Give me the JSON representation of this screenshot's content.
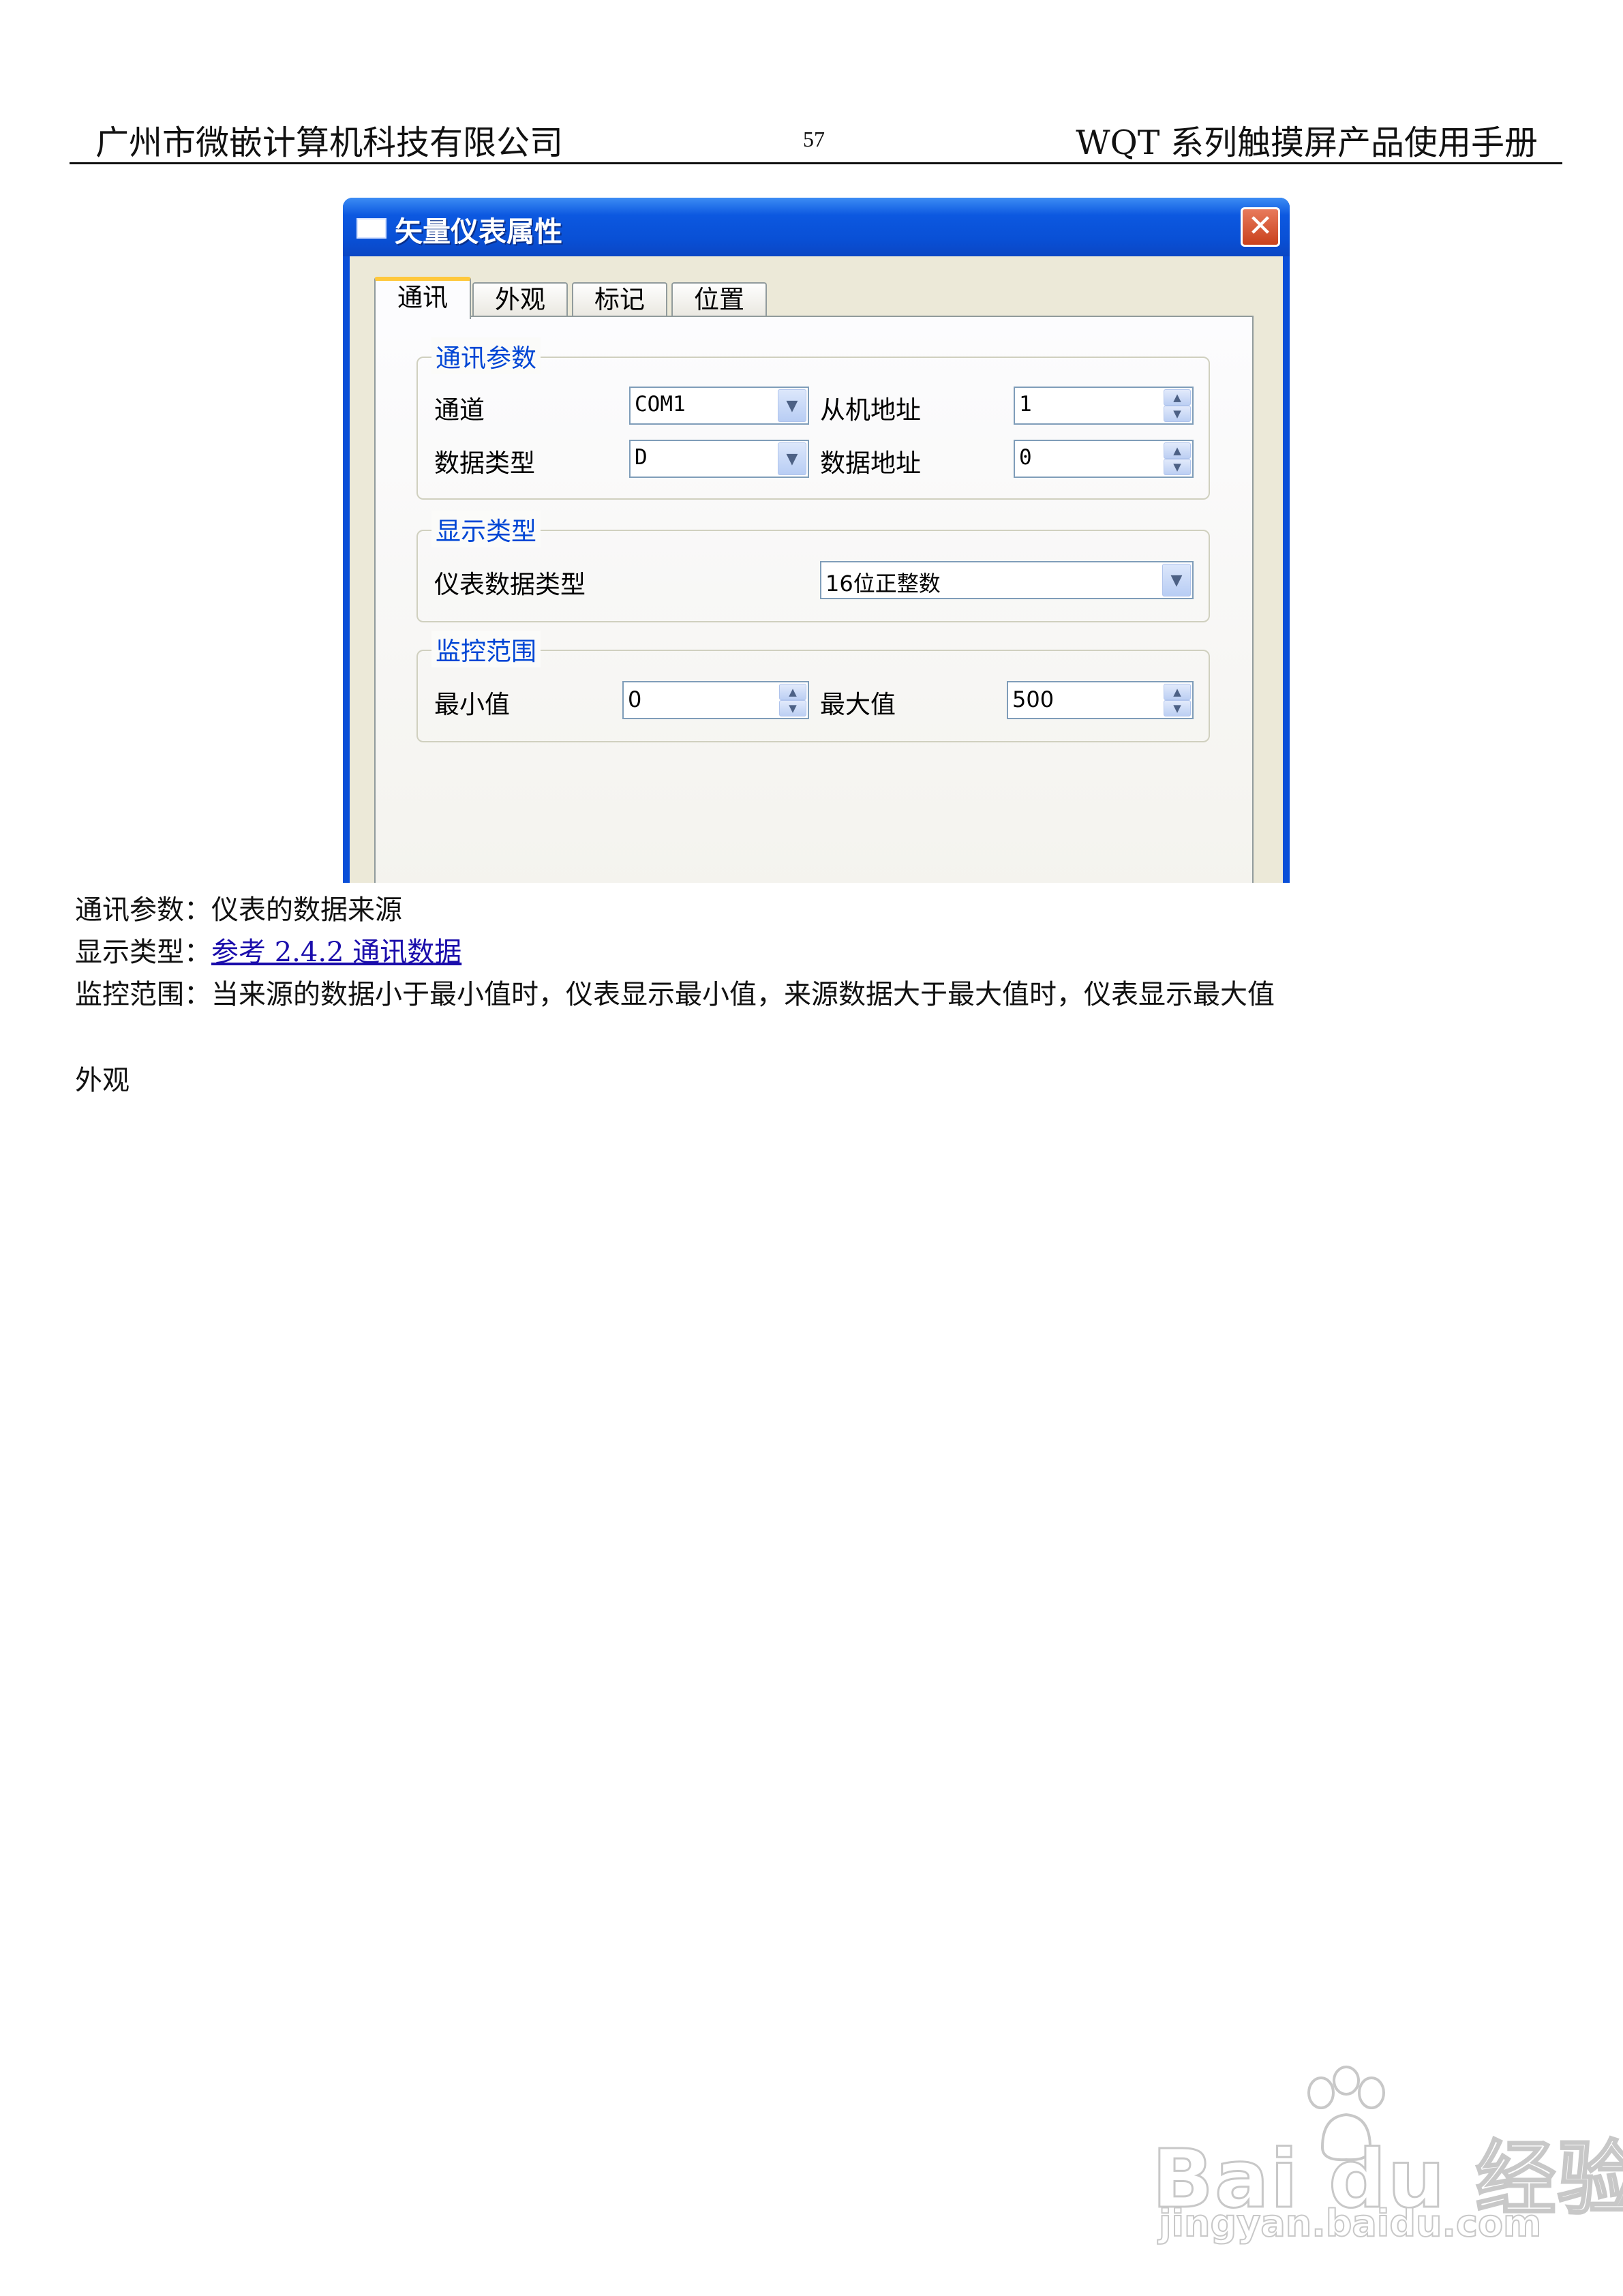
{
  "header": {
    "company": "广州市微嵌计算机科技有限公司",
    "page_number": "57",
    "manual_title": "WQT 系列触摸屏产品使用手册"
  },
  "dialog": {
    "title": "矢量仪表属性",
    "close_glyph": "✕",
    "tabs": [
      {
        "label": "通讯",
        "active": true
      },
      {
        "label": "外观",
        "active": false
      },
      {
        "label": "标记",
        "active": false
      },
      {
        "label": "位置",
        "active": false
      }
    ],
    "comm_group": {
      "title": "通讯参数",
      "channel_label": "通道",
      "channel_value": "COM1",
      "slave_label": "从机地址",
      "slave_value": "1",
      "datatype_label": "数据类型",
      "datatype_value": "D",
      "dataaddr_label": "数据地址",
      "dataaddr_value": "0"
    },
    "display_group": {
      "title": "显示类型",
      "meter_type_label": "仪表数据类型",
      "meter_type_value": "16位正整数"
    },
    "range_group": {
      "title": "监控范围",
      "min_label": "最小值",
      "min_value": "0",
      "max_label": "最大值",
      "max_value": "500"
    }
  },
  "body": {
    "line1_label": "通讯参数：",
    "line1_text": "仪表的数据来源",
    "line2_label": "显示类型：",
    "line2_link": "参考 2.4.2 通讯数据",
    "line3_label": "监控范围：",
    "line3_text": "当来源的数据小于最小值时，仪表显示最小值，来源数据大于最大值时，仪表显示最大值",
    "section_heading": "外观"
  },
  "watermark": {
    "brand": "Bai du 经验",
    "url": "jingyan.baidu.com"
  }
}
